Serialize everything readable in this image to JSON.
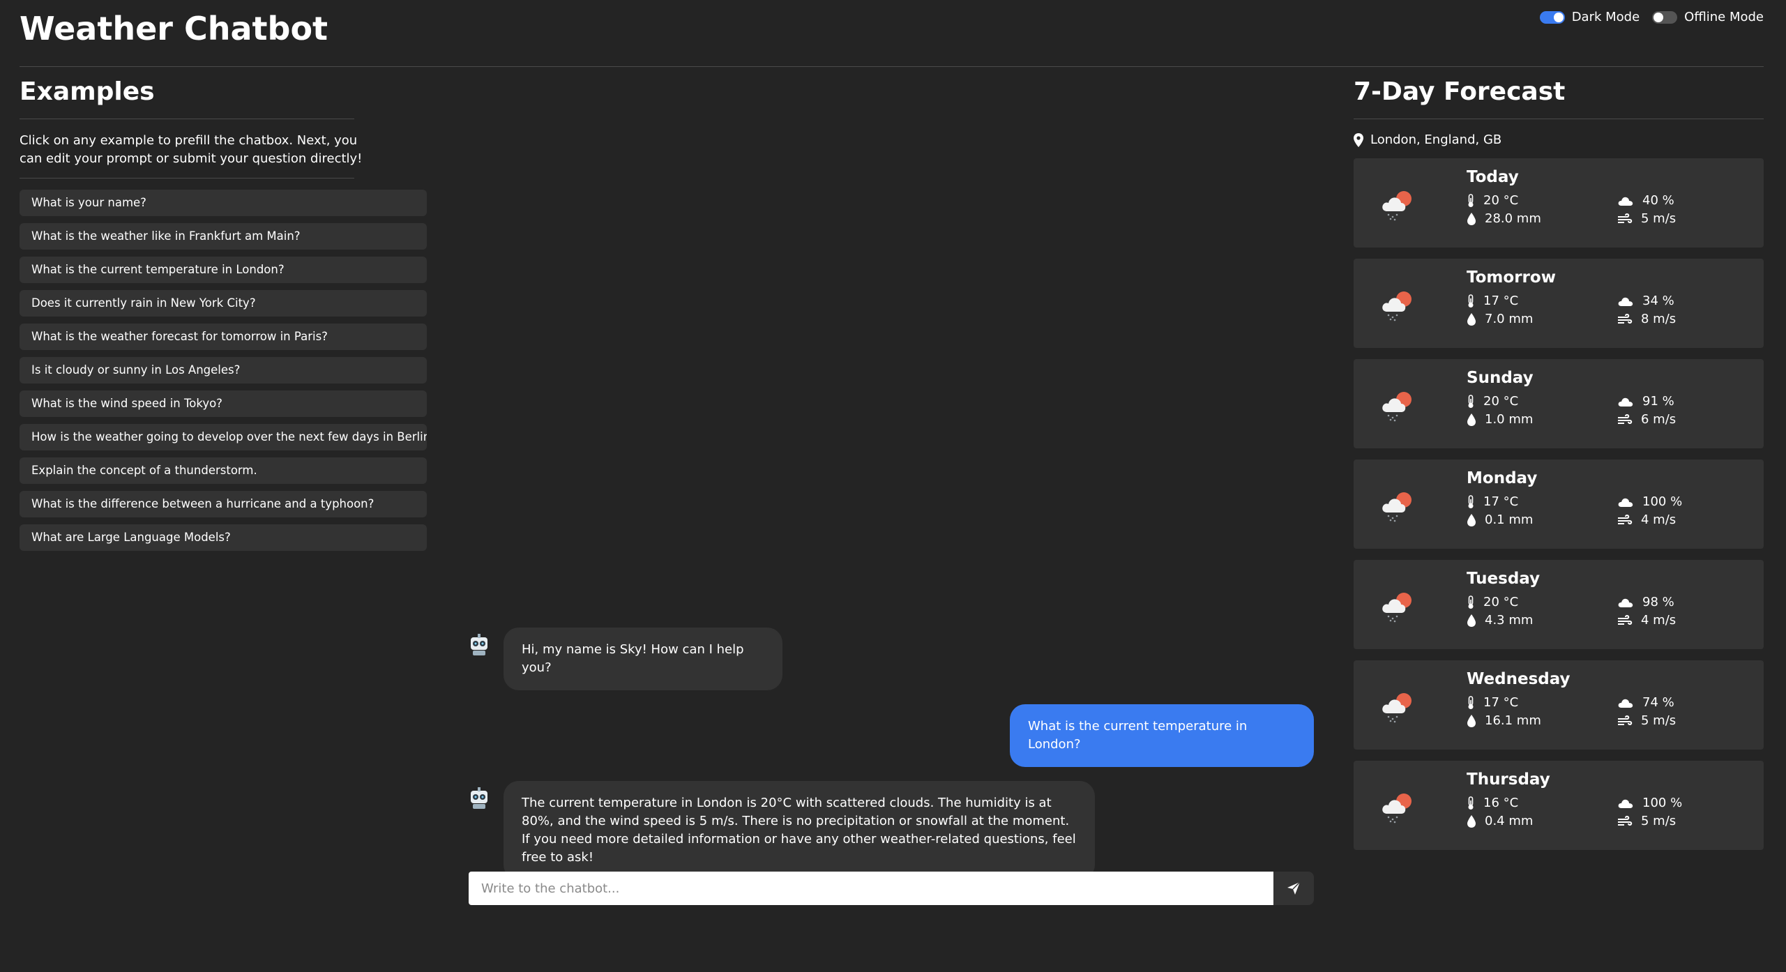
{
  "app": {
    "title": "Weather Chatbot"
  },
  "toggles": {
    "dark_mode_label": "Dark Mode",
    "offline_mode_label": "Offline Mode",
    "dark_mode_on": true,
    "offline_mode_on": false
  },
  "examples": {
    "heading": "Examples",
    "description": "Click on any example to prefill the chatbox. Next, you can edit your prompt or submit your question directly!",
    "items": [
      "What is your name?",
      "What is the weather like in Frankfurt am Main?",
      "What is the current temperature in London?",
      "Does it currently rain in New York City?",
      "What is the weather forecast for tomorrow in Paris?",
      "Is it cloudy or sunny in Los Angeles?",
      "What is the wind speed in Tokyo?",
      "How is the weather going to develop over the next few days in Berlin?",
      "Explain the concept of a thunderstorm.",
      "What is the difference between a hurricane and a typhoon?",
      "What are Large Language Models?"
    ]
  },
  "chat": {
    "messages": [
      {
        "role": "bot",
        "text": "Hi, my name is Sky! How can I help you?"
      },
      {
        "role": "user",
        "text": "What is the current temperature in London?"
      },
      {
        "role": "bot",
        "text": "The current temperature in London is 20°C with scattered clouds. The humidity is at 80%, and the wind speed is 5 m/s. There is no precipitation or snowfall at the moment. If you need more detailed information or have any other weather-related questions, feel free to ask!"
      }
    ],
    "input_placeholder": "Write to the chatbot...",
    "input_value": ""
  },
  "forecast": {
    "heading": "7-Day Forecast",
    "location": "London, England, GB",
    "days": [
      {
        "name": "Today",
        "temp": "20 °C",
        "precip": "28.0 mm",
        "clouds": "40 %",
        "wind": "5 m/s"
      },
      {
        "name": "Tomorrow",
        "temp": "17 °C",
        "precip": "7.0 mm",
        "clouds": "34 %",
        "wind": "8 m/s"
      },
      {
        "name": "Sunday",
        "temp": "20 °C",
        "precip": "1.0 mm",
        "clouds": "91 %",
        "wind": "6 m/s"
      },
      {
        "name": "Monday",
        "temp": "17 °C",
        "precip": "0.1 mm",
        "clouds": "100 %",
        "wind": "4 m/s"
      },
      {
        "name": "Tuesday",
        "temp": "20 °C",
        "precip": "4.3 mm",
        "clouds": "98 %",
        "wind": "4 m/s"
      },
      {
        "name": "Wednesday",
        "temp": "17 °C",
        "precip": "16.1 mm",
        "clouds": "74 %",
        "wind": "5 m/s"
      },
      {
        "name": "Thursday",
        "temp": "16 °C",
        "precip": "0.4 mm",
        "clouds": "100 %",
        "wind": "5 m/s"
      }
    ]
  },
  "colors": {
    "background": "#242424",
    "card": "#333333",
    "accent": "#3a7bf0",
    "sun": "#e8644a"
  },
  "icons": {
    "location": "map-pin-icon",
    "temp": "thermometer-icon",
    "precip": "droplet-icon",
    "clouds": "cloud-icon",
    "wind": "wind-icon",
    "weather": "cloud-sun-rain-icon",
    "send": "send-icon",
    "bot": "robot-avatar-icon"
  }
}
